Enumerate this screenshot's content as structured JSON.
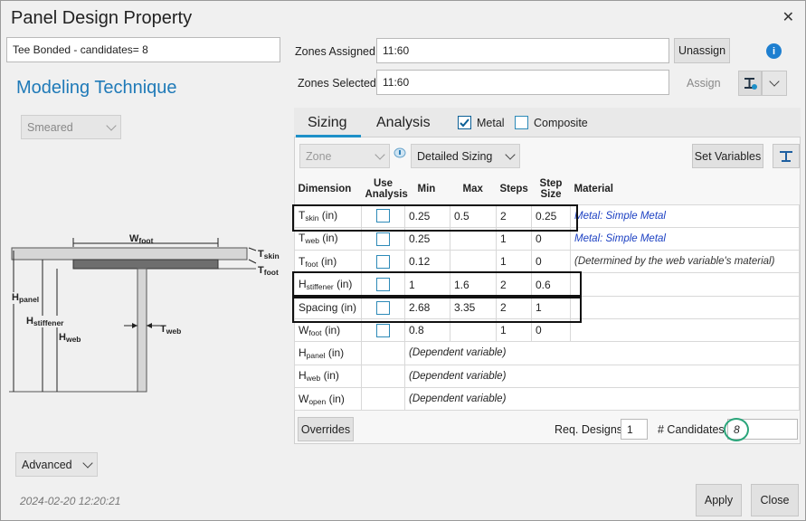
{
  "window": {
    "title": "Panel Design Property",
    "close_glyph": "✕"
  },
  "left": {
    "concept_value": "Tee Bonded - candidates= 8",
    "heading": "Modeling Technique",
    "technique": "Smeared",
    "advanced": "Advanced",
    "timestamp": "2024-02-20 12:20:21"
  },
  "zones": {
    "assigned_label": "Zones Assigned:",
    "assigned_value": "11:60",
    "selected_label": "Zones Selected:",
    "selected_value": "11:60",
    "unassign": "Unassign",
    "assign": "Assign",
    "info_glyph": "i"
  },
  "tabs": {
    "sizing": "Sizing",
    "analysis": "Analysis",
    "metal": "Metal",
    "composite": "Composite",
    "metal_checked": true,
    "composite_checked": false
  },
  "toolbar": {
    "zone": "Zone",
    "detailed": "Detailed Sizing",
    "set_variables": "Set Variables"
  },
  "table": {
    "headers": [
      "Dimension",
      "Use Analysis",
      "Min",
      "Max",
      "Steps",
      "Step Size",
      "Material"
    ],
    "rows": [
      {
        "base": "T",
        "sub": "skin",
        "unit": " (in)",
        "min": "0.25",
        "max": "0.5",
        "steps": "2",
        "step": "0.25",
        "material": "Metal: Simple Metal",
        "mtype": "mat"
      },
      {
        "base": "T",
        "sub": "web",
        "unit": " (in)",
        "min": "0.25",
        "max": "",
        "steps": "1",
        "step": "0",
        "material": "Metal: Simple Metal",
        "mtype": "mat"
      },
      {
        "base": "T",
        "sub": "foot",
        "unit": " (in)",
        "min": "0.12",
        "max": "",
        "steps": "1",
        "step": "0",
        "material": "(Determined by the web variable's material)",
        "mtype": "det"
      },
      {
        "base": "H",
        "sub": "stiffener",
        "unit": " (in)",
        "min": "1",
        "max": "1.6",
        "steps": "2",
        "step": "0.6",
        "material": "",
        "mtype": ""
      },
      {
        "base": "Spacing",
        "sub": "",
        "unit": " (in)",
        "min": "2.68",
        "max": "3.35",
        "steps": "2",
        "step": "1",
        "material": "",
        "mtype": ""
      },
      {
        "base": "W",
        "sub": "foot",
        "unit": " (in)",
        "min": "0.8",
        "max": "",
        "steps": "1",
        "step": "0",
        "material": "",
        "mtype": ""
      },
      {
        "base": "H",
        "sub": "panel",
        "unit": " (in)",
        "dep": "(Dependent variable)"
      },
      {
        "base": "H",
        "sub": "web",
        "unit": " (in)",
        "dep": "(Dependent variable)"
      },
      {
        "base": "W",
        "sub": "open",
        "unit": " (in)",
        "dep": "(Dependent variable)"
      }
    ]
  },
  "footer": {
    "overrides": "Overrides",
    "req_label": "Req. Designs",
    "req_value": "1",
    "cand_label": "# Candidates",
    "cand_value": "8"
  },
  "diagram": {
    "w_foot": "W",
    "w_foot_sub": "foot",
    "t_skin": "T",
    "t_skin_sub": "skin",
    "t_foot": "T",
    "t_foot_sub": "foot",
    "h_panel": "H",
    "h_panel_sub": "panel",
    "h_stiffener": "H",
    "h_stiffener_sub": "stiffener",
    "h_web": "H",
    "h_web_sub": "web",
    "t_web": "T",
    "t_web_sub": "web"
  },
  "buttons": {
    "apply": "Apply",
    "close": "Close"
  },
  "colors": {
    "accent": "#1e90c8",
    "heading": "#1f7ab8",
    "material_link": "#1a3fc2",
    "candidate_ring": "#2aa57a"
  }
}
